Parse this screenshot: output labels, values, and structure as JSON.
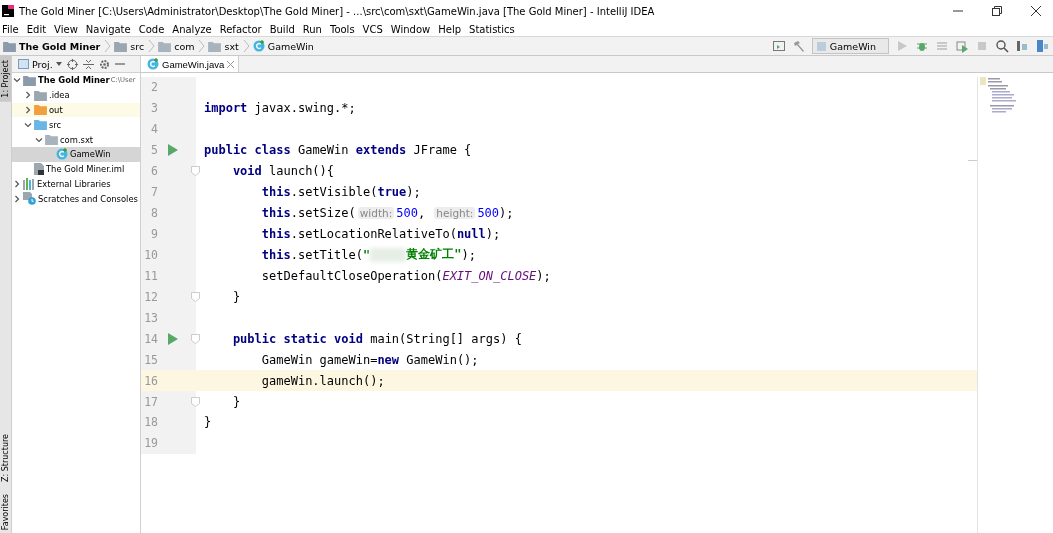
{
  "window": {
    "title": "The Gold Miner [C:\\Users\\Administrator\\Desktop\\The Gold Miner] - ...\\src\\com\\sxt\\GameWin.java [The Gold Miner] - IntelliJ IDEA"
  },
  "menu": [
    "File",
    "Edit",
    "View",
    "Navigate",
    "Code",
    "Analyze",
    "Refactor",
    "Build",
    "Run",
    "Tools",
    "VCS",
    "Window",
    "Help",
    "Statistics"
  ],
  "breadcrumbs": [
    {
      "label": "The Gold Miner",
      "kind": "project"
    },
    {
      "label": "src",
      "kind": "folder"
    },
    {
      "label": "com",
      "kind": "package"
    },
    {
      "label": "sxt",
      "kind": "package"
    },
    {
      "label": "GameWin",
      "kind": "class"
    }
  ],
  "run_config": {
    "label": "GameWin"
  },
  "side_tabs_top": [
    {
      "label": "1: Project",
      "selected": true
    }
  ],
  "side_tabs_bottom": [
    {
      "label": "Z: Structure",
      "selected": false
    },
    {
      "label": "Favorites",
      "selected": false
    }
  ],
  "project_panel": {
    "title": "Proj.",
    "tree": [
      {
        "label": "The Gold Miner",
        "hint": "C:\\User",
        "kind": "project",
        "expanded": true,
        "selected": false,
        "excluded": false,
        "children": [
          {
            "label": ".idea",
            "kind": "folder",
            "expanded": false,
            "selected": false,
            "excluded": false
          },
          {
            "label": "out",
            "kind": "folder",
            "expanded": false,
            "selected": false,
            "excluded": true
          },
          {
            "label": "src",
            "kind": "source",
            "expanded": true,
            "selected": false,
            "excluded": false,
            "children": [
              {
                "label": "com.sxt",
                "kind": "package",
                "expanded": true,
                "selected": false,
                "excluded": false,
                "children": [
                  {
                    "label": "GameWin",
                    "kind": "class",
                    "selected": true,
                    "excluded": false
                  }
                ]
              }
            ]
          },
          {
            "label": "The Gold Miner.iml",
            "kind": "file",
            "selected": false,
            "excluded": false
          }
        ]
      },
      {
        "label": "External Libraries",
        "kind": "library",
        "expanded": false,
        "selected": false,
        "excluded": false
      },
      {
        "label": "Scratches and Consoles",
        "kind": "scratch",
        "expanded": false,
        "selected": false,
        "excluded": false
      }
    ]
  },
  "editor_tabs": [
    {
      "label": "GameWin.java",
      "selected": true
    }
  ],
  "code": [
    {
      "number": "2",
      "current": false,
      "run_marker": false,
      "fold_marker": false
    },
    {
      "number": "3",
      "current": false,
      "run_marker": false,
      "fold_marker": false,
      "tokens": [
        {
          "kind": "kw",
          "t": "import"
        },
        {
          "kind": "plain",
          "t": " javax.swing.*;"
        }
      ]
    },
    {
      "number": "4",
      "current": false,
      "run_marker": false,
      "fold_marker": false
    },
    {
      "number": "5",
      "current": false,
      "run_marker": true,
      "fold_marker": false,
      "tokens": [
        {
          "kind": "kw",
          "t": "public class"
        },
        {
          "kind": "plain",
          "t": " GameWin "
        },
        {
          "kind": "kw",
          "t": "extends"
        },
        {
          "kind": "plain",
          "t": " JFrame {"
        }
      ]
    },
    {
      "number": "6",
      "current": false,
      "run_marker": false,
      "fold_marker": true,
      "tokens": [
        {
          "kind": "kw",
          "t": "    void"
        },
        {
          "kind": "plain",
          "t": " launch(){"
        }
      ]
    },
    {
      "number": "7",
      "current": false,
      "run_marker": false,
      "fold_marker": false,
      "tokens": [
        {
          "kind": "kw",
          "t": "        this"
        },
        {
          "kind": "plain",
          "t": ".setVisible("
        },
        {
          "kind": "kw",
          "t": "true"
        },
        {
          "kind": "plain",
          "t": ");"
        }
      ]
    },
    {
      "number": "8",
      "current": false,
      "run_marker": false,
      "fold_marker": false,
      "tokens": [
        {
          "kind": "kw",
          "t": "        this"
        },
        {
          "kind": "plain",
          "t": ".setSize("
        },
        {
          "kind": "hint",
          "t": "width:"
        },
        {
          "kind": "num",
          "t": "500"
        },
        {
          "kind": "plain",
          "t": ", "
        },
        {
          "kind": "hint",
          "t": "height:"
        },
        {
          "kind": "num",
          "t": "500"
        },
        {
          "kind": "plain",
          "t": ");"
        }
      ]
    },
    {
      "number": "9",
      "current": false,
      "run_marker": false,
      "fold_marker": false,
      "tokens": [
        {
          "kind": "kw",
          "t": "        this"
        },
        {
          "kind": "plain",
          "t": ".setLocationRelativeTo("
        },
        {
          "kind": "kw",
          "t": "null"
        },
        {
          "kind": "plain",
          "t": ");"
        }
      ]
    },
    {
      "number": "10",
      "current": false,
      "run_marker": false,
      "fold_marker": false,
      "tokens": [
        {
          "kind": "kw",
          "t": "        this"
        },
        {
          "kind": "plain",
          "t": ".setTitle("
        },
        {
          "kind": "str",
          "t": "\""
        },
        {
          "kind": "blur"
        },
        {
          "kind": "str",
          "t": "黄金矿工\""
        },
        {
          "kind": "plain",
          "t": ");"
        }
      ]
    },
    {
      "number": "11",
      "current": false,
      "run_marker": false,
      "fold_marker": false,
      "tokens": [
        {
          "kind": "plain",
          "t": "        setDefaultCloseOperation("
        },
        {
          "kind": "const",
          "t": "EXIT_ON_CLOSE"
        },
        {
          "kind": "plain",
          "t": ");"
        }
      ]
    },
    {
      "number": "12",
      "current": false,
      "run_marker": false,
      "fold_marker": true,
      "tokens": [
        {
          "kind": "plain",
          "t": "    }"
        }
      ]
    },
    {
      "number": "13",
      "current": false,
      "run_marker": false,
      "fold_marker": false
    },
    {
      "number": "14",
      "current": false,
      "run_marker": true,
      "fold_marker": true,
      "tokens": [
        {
          "kind": "kw",
          "t": "    public static void"
        },
        {
          "kind": "plain",
          "t": " main(String[] args) {"
        }
      ]
    },
    {
      "number": "15",
      "current": false,
      "run_marker": false,
      "fold_marker": false,
      "tokens": [
        {
          "kind": "plain",
          "t": "        GameWin gameWin="
        },
        {
          "kind": "kw",
          "t": "new"
        },
        {
          "kind": "plain",
          "t": " GameWin();"
        }
      ]
    },
    {
      "number": "16",
      "current": true,
      "run_marker": false,
      "fold_marker": false,
      "tokens": [
        {
          "kind": "plain",
          "t": "        gameWin.launch();"
        }
      ]
    },
    {
      "number": "17",
      "current": false,
      "run_marker": false,
      "fold_marker": true,
      "tokens": [
        {
          "kind": "plain",
          "t": "    }"
        }
      ]
    },
    {
      "number": "18",
      "current": false,
      "run_marker": false,
      "fold_marker": false,
      "tokens": [
        {
          "kind": "plain",
          "t": "}"
        }
      ]
    },
    {
      "number": "19",
      "current": false,
      "run_marker": false,
      "fold_marker": false
    }
  ]
}
